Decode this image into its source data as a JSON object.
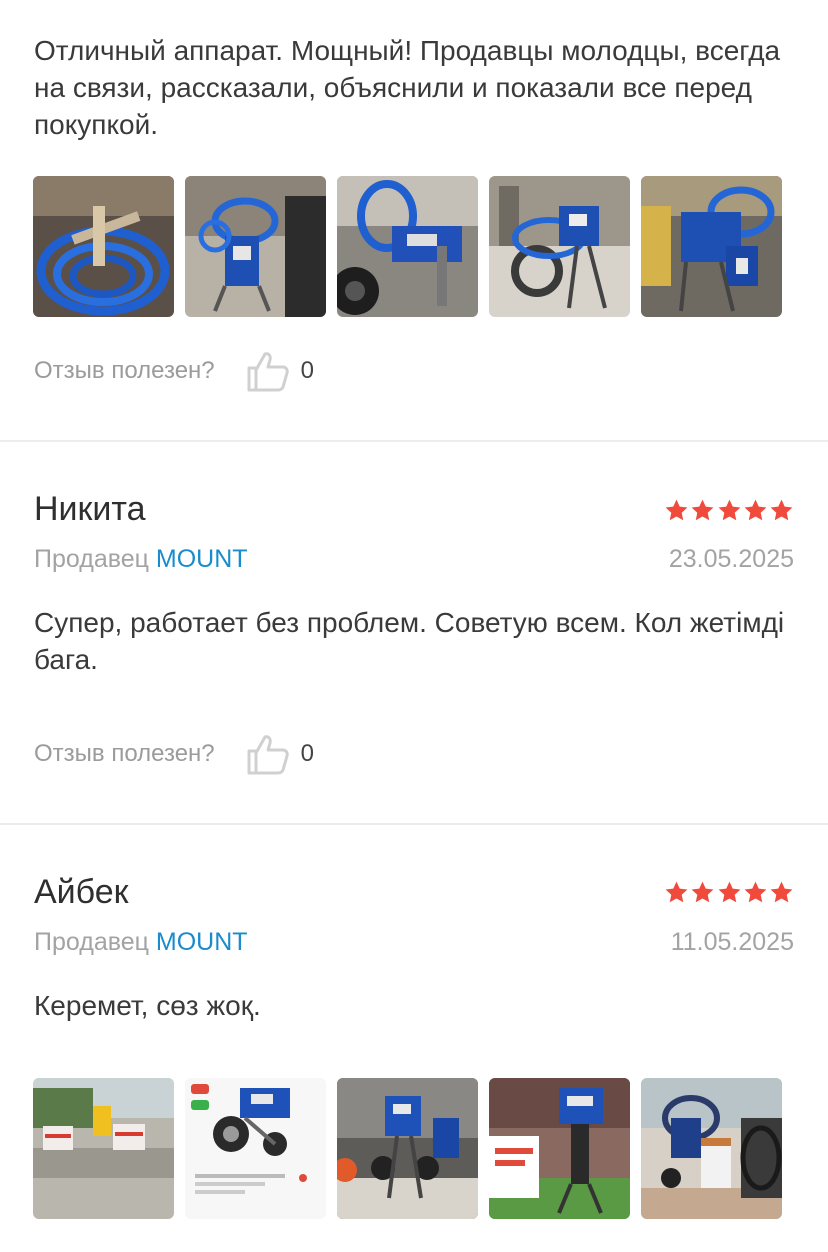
{
  "reviews": [
    {
      "text": "Отличный аппарат. Мощный! Продавцы молодцы, всегда на связи, рассказали, объяснили и показали все перед покупкой.",
      "photos": [
        "review-photo",
        "review-photo",
        "review-photo",
        "review-photo",
        "review-photo"
      ],
      "helpful_label": "Отзыв полезен?",
      "likes": "0"
    },
    {
      "author": "Никита",
      "rating": 5,
      "seller_label": "Продавец",
      "seller_name": "MOUNT",
      "date": "23.05.2025",
      "text": "Супер, работает без проблем. Советую всем. Кол жетімді бага.",
      "helpful_label": "Отзыв полезен?",
      "likes": "0"
    },
    {
      "author": "Айбек",
      "rating": 5,
      "seller_label": "Продавец",
      "seller_name": "MOUNT",
      "date": "11.05.2025",
      "text": "Керемет, сөз жоқ.",
      "photos": [
        "review-photo",
        "review-photo",
        "review-photo",
        "review-photo",
        "review-photo"
      ]
    }
  ],
  "colors": {
    "star": "#f04a3d",
    "seller_link": "#1a8ccc",
    "muted_text": "#a3a3a3",
    "divider": "#ececec"
  },
  "icons": {
    "like": "thumbs-up-icon",
    "star": "star-icon"
  }
}
